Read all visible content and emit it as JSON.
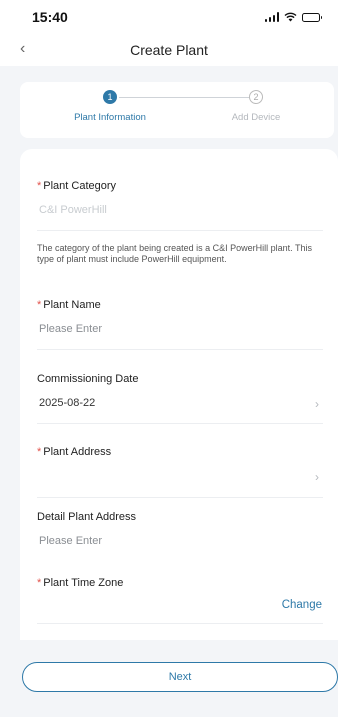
{
  "status_bar": {
    "time": "15:40"
  },
  "nav": {
    "back_icon": "chevron-left-icon",
    "title": "Create Plant"
  },
  "stepper": {
    "steps": [
      {
        "number": "1",
        "label": "Plant Information",
        "state": "active"
      },
      {
        "number": "2",
        "label": "Add Device",
        "state": "inactive"
      }
    ]
  },
  "form": {
    "plant_category": {
      "label": "Plant Category",
      "required": "*",
      "value": "C&I PowerHill"
    },
    "category_note": "The category of the plant being created is a C&I PowerHill plant. This type of plant must include PowerHill equipment.",
    "plant_name": {
      "label": "Plant Name",
      "required": "*",
      "placeholder": "Please Enter"
    },
    "commissioning_date": {
      "label": "Commissioning Date",
      "value": "2025-08-22"
    },
    "plant_address": {
      "label": "Plant Address",
      "required": "*"
    },
    "detail_address": {
      "label": "Detail Plant Address",
      "placeholder": "Please Enter"
    },
    "time_zone": {
      "label": "Plant Time Zone",
      "required": "*",
      "action": "Change"
    },
    "next_required": "*"
  },
  "footer": {
    "next_label": "Next"
  },
  "colors": {
    "accent": "#2e79a8",
    "required": "#e2524b",
    "background": "#f3f5f8"
  }
}
